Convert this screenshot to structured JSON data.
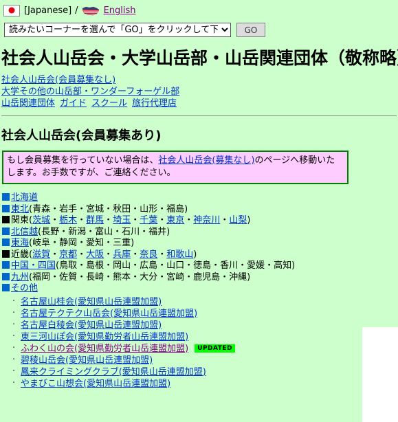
{
  "language_bar": {
    "jp_flag_icon": "japan-flag-icon",
    "jp_label": "[Japanese]",
    "separator": "/",
    "us_flag_icon": "usa-flag-icon",
    "en_label": "English"
  },
  "corner_selector": {
    "selected_option": "読みたいコーナーを選んで「GO」をクリックして下さい",
    "options": [
      "読みたいコーナーを選んで「GO」をクリックして下さい"
    ],
    "go_label": "GO"
  },
  "page_title": "社会人山岳会・大学山岳部・山岳関連団体（敬称略）",
  "nav_links": {
    "line1": "社会人山岳会(会員募集なし)",
    "line2": "大学その他の山岳部・ワンダーフォーゲル部",
    "line3_a": "山岳関連団体",
    "line3_b": "ガイド",
    "line3_c": "スクール",
    "line3_d": "旅行代理店"
  },
  "section_title": "社会人山岳会(会員募集あり)",
  "notice": {
    "text_before": "もし会員募集を行っていない場合は、",
    "link": "社会人山岳会(募集なし)",
    "text_after": "のページへ移動いたします。お手数ですが、ご連絡ください。"
  },
  "regions": [
    {
      "bullet_color": "#0066cc",
      "name": "北海道",
      "name_is_link": true,
      "suffix": "",
      "prefectures": []
    },
    {
      "bullet_color": "#0066cc",
      "name": "東北",
      "name_is_link": true,
      "suffix": "(青森・岩手・宮城・秋田・山形・福島)",
      "prefectures": []
    },
    {
      "bullet_color": "#000000",
      "name": "関東",
      "name_is_link": false,
      "suffix": "",
      "prefectures": [
        "茨城",
        "栃木",
        "群馬",
        "埼玉",
        "千葉",
        "東京",
        "神奈川",
        "山梨"
      ]
    },
    {
      "bullet_color": "#0066cc",
      "name": "北信越",
      "name_is_link": true,
      "suffix": "(長野・新潟・富山・石川・福井)",
      "prefectures": []
    },
    {
      "bullet_color": "#0066cc",
      "name": "東海",
      "name_is_link": true,
      "suffix": "(岐阜・静岡・愛知・三重)",
      "prefectures": []
    },
    {
      "bullet_color": "#000000",
      "name": "近畿",
      "name_is_link": false,
      "suffix": "",
      "prefectures": [
        "滋賀",
        "京都",
        "大阪",
        "兵庫",
        "奈良",
        "和歌山"
      ]
    },
    {
      "bullet_color": "#0066cc",
      "name": "中国・四国",
      "name_is_link": true,
      "suffix": "(鳥取・島根・岡山・広島・山口・徳島・香川・愛媛・高知)",
      "prefectures": []
    },
    {
      "bullet_color": "#0066cc",
      "name": "九州",
      "name_is_link": true,
      "suffix": "(福岡・佐賀・長崎・熊本・大分・宮崎・鹿児島・沖縄)",
      "prefectures": []
    },
    {
      "bullet_color": "#0066cc",
      "name": "その他",
      "name_is_link": true,
      "suffix": "",
      "prefectures": []
    }
  ],
  "clubs": [
    {
      "label": "名古屋山桂会(愛知県山岳連盟加盟)",
      "visited": false,
      "badge": ""
    },
    {
      "label": "名古屋テクテク山岳会(愛知県山岳連盟加盟)",
      "visited": false,
      "badge": ""
    },
    {
      "label": "名古屋白稜会(愛知県山岳連盟加盟)",
      "visited": false,
      "badge": ""
    },
    {
      "label": "東三河山ぽ会(愛知県勤労者山岳連盟加盟)",
      "visited": false,
      "badge": ""
    },
    {
      "label": "ふわく山の会(愛知県勤労者山岳連盟加盟)",
      "visited": true,
      "badge": "UPDATED"
    },
    {
      "label": "碧稜山岳会(愛知県山岳連盟加盟)",
      "visited": false,
      "badge": ""
    },
    {
      "label": "鳳来クライミングクラブ(愛知県山岳連盟加盟)",
      "visited": false,
      "badge": ""
    },
    {
      "label": "やまびこ山想会(愛知県山岳連盟加盟)",
      "visited": false,
      "badge": ""
    }
  ],
  "colors": {
    "background": "#ccffcc",
    "link_unvisited": "#0033cc",
    "link_visited": "#800080",
    "notice_bg": "#ffccff",
    "notice_border": "#008000",
    "bullet_blue": "#0066cc",
    "bullet_black": "#000000",
    "badge_bg": "#00ff00"
  }
}
